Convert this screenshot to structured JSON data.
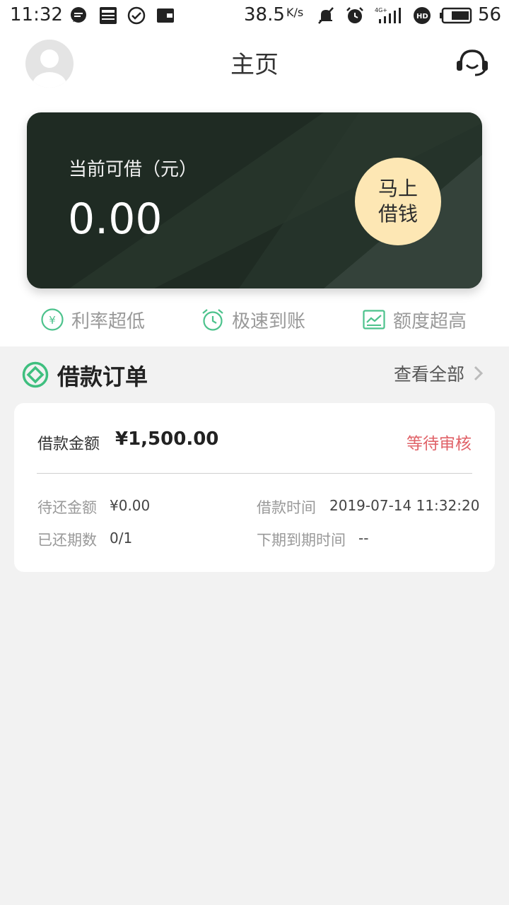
{
  "status_bar": {
    "time": "11:32",
    "speed": "38.5",
    "speed_unit": "K/s",
    "battery": "56"
  },
  "header": {
    "title": "主页"
  },
  "balance_card": {
    "label": "当前可借（元）",
    "amount": "0.00",
    "button_line1": "马上",
    "button_line2": "借钱"
  },
  "features": [
    {
      "label": "利率超低",
      "icon": "yen-circle-icon"
    },
    {
      "label": "极速到账",
      "icon": "alarm-clock-icon"
    },
    {
      "label": "额度超高",
      "icon": "line-chart-icon"
    }
  ],
  "orders_section": {
    "title": "借款订单",
    "view_all": "查看全部"
  },
  "order": {
    "amount_label": "借款金额",
    "amount": "¥1,500.00",
    "status": "等待审核",
    "pending_label": "待还金额",
    "pending_value": "¥0.00",
    "time_label": "借款时间",
    "time_value": "2019-07-14 11:32:20",
    "periods_label": "已还期数",
    "periods_value": "0/1",
    "due_label": "下期到期时间",
    "due_value": "--"
  },
  "colors": {
    "accent_green": "#3fbf7f",
    "card_bg": "#1f2b23",
    "button_bg": "#fde7b4",
    "status_red": "#e06268"
  }
}
